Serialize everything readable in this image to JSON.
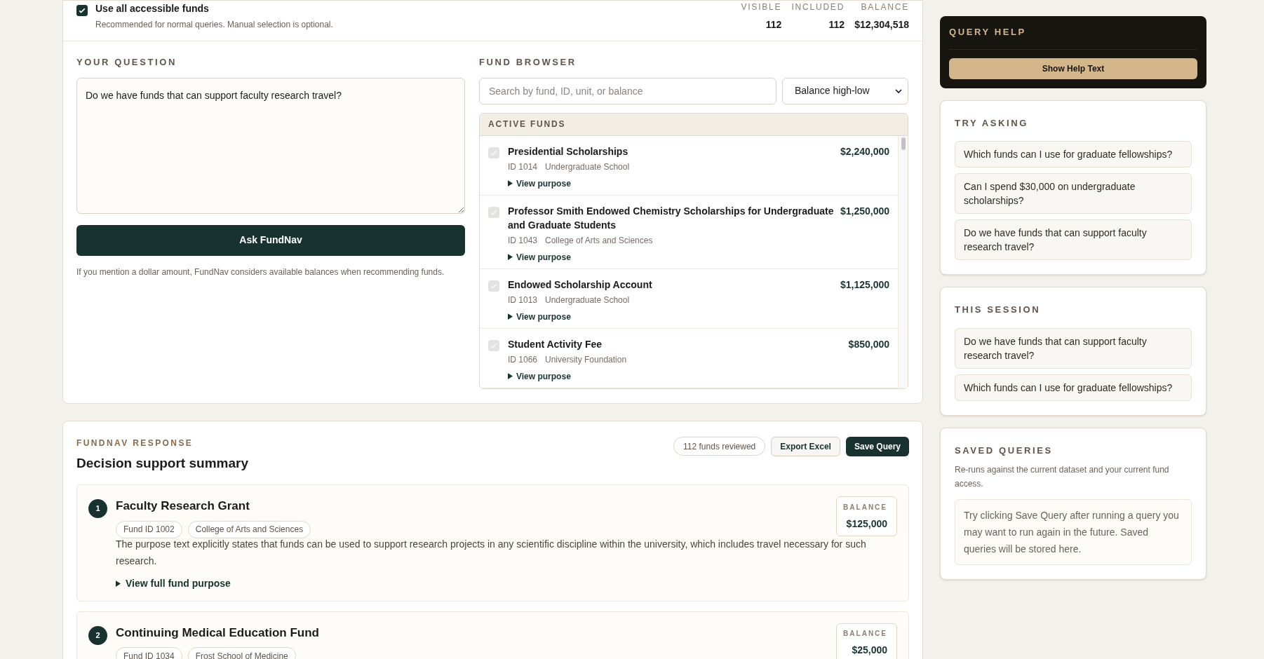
{
  "scope": {
    "use_all": {
      "label": "Use all accessible funds",
      "description": "Recommended for normal queries. Manual selection is optional.",
      "checked": true
    },
    "stats": [
      {
        "label": "VISIBLE",
        "value": "112"
      },
      {
        "label": "INCLUDED",
        "value": "112"
      },
      {
        "label": "BALANCE",
        "value": "$12,304,518"
      }
    ]
  },
  "question": {
    "heading": "YOUR QUESTION",
    "value": "Do we have funds that can support faculty research travel?",
    "button": "Ask FundNav",
    "note": "If you mention a dollar amount, FundNav considers available balances when recommending funds."
  },
  "fund_browser": {
    "heading": "FUND BROWSER",
    "search": {
      "placeholder": "Search by fund, ID, unit, or balance"
    },
    "sort": {
      "value": "Balance high-low"
    },
    "list_heading": "ACTIVE FUNDS",
    "funds": [
      {
        "name": "Presidential Scholarships",
        "id": "ID 1014",
        "unit": "Undergraduate School",
        "balance": "$2,240,000",
        "checked": true,
        "disabled": true,
        "link": "View purpose"
      },
      {
        "name": "Professor Smith Endowed Chemistry Scholarships for Undergraduate and Graduate Students",
        "id": "ID 1043",
        "unit": "College of Arts and Sciences",
        "balance": "$1,250,000",
        "checked": true,
        "disabled": true,
        "link": "View purpose"
      },
      {
        "name": "Endowed Scholarship Account",
        "id": "ID 1013",
        "unit": "Undergraduate School",
        "balance": "$1,125,000",
        "checked": true,
        "disabled": true,
        "link": "View purpose"
      },
      {
        "name": "Student Activity Fee",
        "id": "ID 1066",
        "unit": "University Foundation",
        "balance": "$850,000",
        "checked": true,
        "disabled": true,
        "link": "View purpose"
      }
    ]
  },
  "response": {
    "eyebrow": "FUNDNAV RESPONSE",
    "title": "Decision support summary",
    "reviewed": "112 funds reviewed",
    "buttons": [
      {
        "label": "Export Excel",
        "kind": "secondary"
      },
      {
        "label": "Save Query",
        "kind": "primary"
      }
    ],
    "results": [
      {
        "rank": "1",
        "name": "Faculty Research Grant",
        "tags": [
          "Fund ID 1002",
          "College of Arts and Sciences"
        ],
        "rationale": "The purpose text explicitly states that funds can be used to support research projects in any scientific discipline within the university, which includes travel necessary for such research.",
        "link": "View full fund purpose",
        "balance_label": "BALANCE",
        "balance": "$125,000"
      },
      {
        "rank": "2",
        "name": "Continuing Medical Education Fund",
        "tags": [
          "Fund ID 1034",
          "Frost School of Medicine"
        ],
        "balance_label": "BALANCE",
        "balance": "$25,000"
      }
    ]
  },
  "sidebar": {
    "help": {
      "heading": "QUERY HELP",
      "button": "Show Help Text"
    },
    "try_asking": {
      "heading": "TRY ASKING",
      "items": [
        "Which funds can I use for graduate fellowships?",
        "Can I spend $30,000 on undergraduate scholarships?",
        "Do we have funds that can support faculty research travel?"
      ]
    },
    "session": {
      "heading": "THIS SESSION",
      "items": [
        "Do we have funds that can support faculty research travel?",
        "Which funds can I use for graduate fellowships?"
      ]
    },
    "saved": {
      "heading": "SAVED QUERIES",
      "description": "Re-runs against the current dataset and your current fund access.",
      "empty": "Try clicking Save Query after running a query you may want to run again in the future. Saved queries will be stored here."
    }
  }
}
